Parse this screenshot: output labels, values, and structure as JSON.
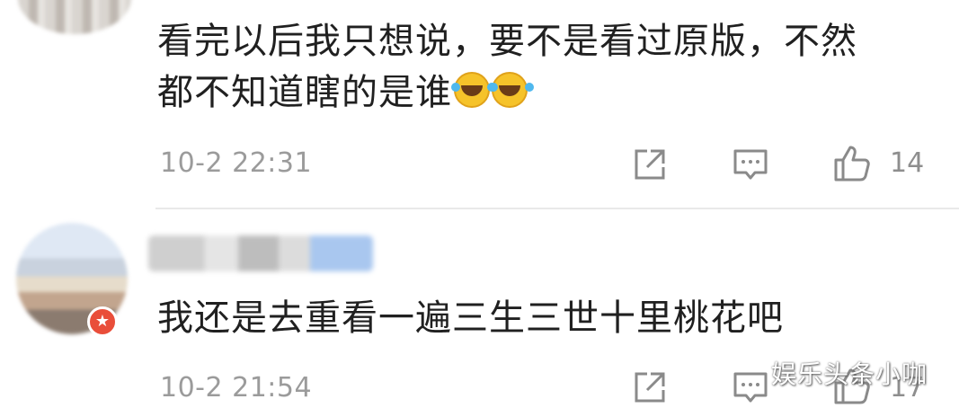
{
  "comments": [
    {
      "text_line1": "看完以后我只想说，要不是看过原版，不然",
      "text_line2": "都不知道瞎的是谁",
      "emojis": [
        "laughing-tears-icon",
        "laughing-tears-icon"
      ],
      "time": "10-2 22:31",
      "likes": "14"
    },
    {
      "text": "我还是去重看一遍三生三世十里桃花吧",
      "time": "10-2 21:54",
      "likes": "17"
    }
  ],
  "watermark": "娱乐头条小咖",
  "colors": {
    "text": "#202020",
    "meta": "#9b9b9b",
    "badge": "#e94e3a",
    "divider": "#e9e9e9"
  }
}
